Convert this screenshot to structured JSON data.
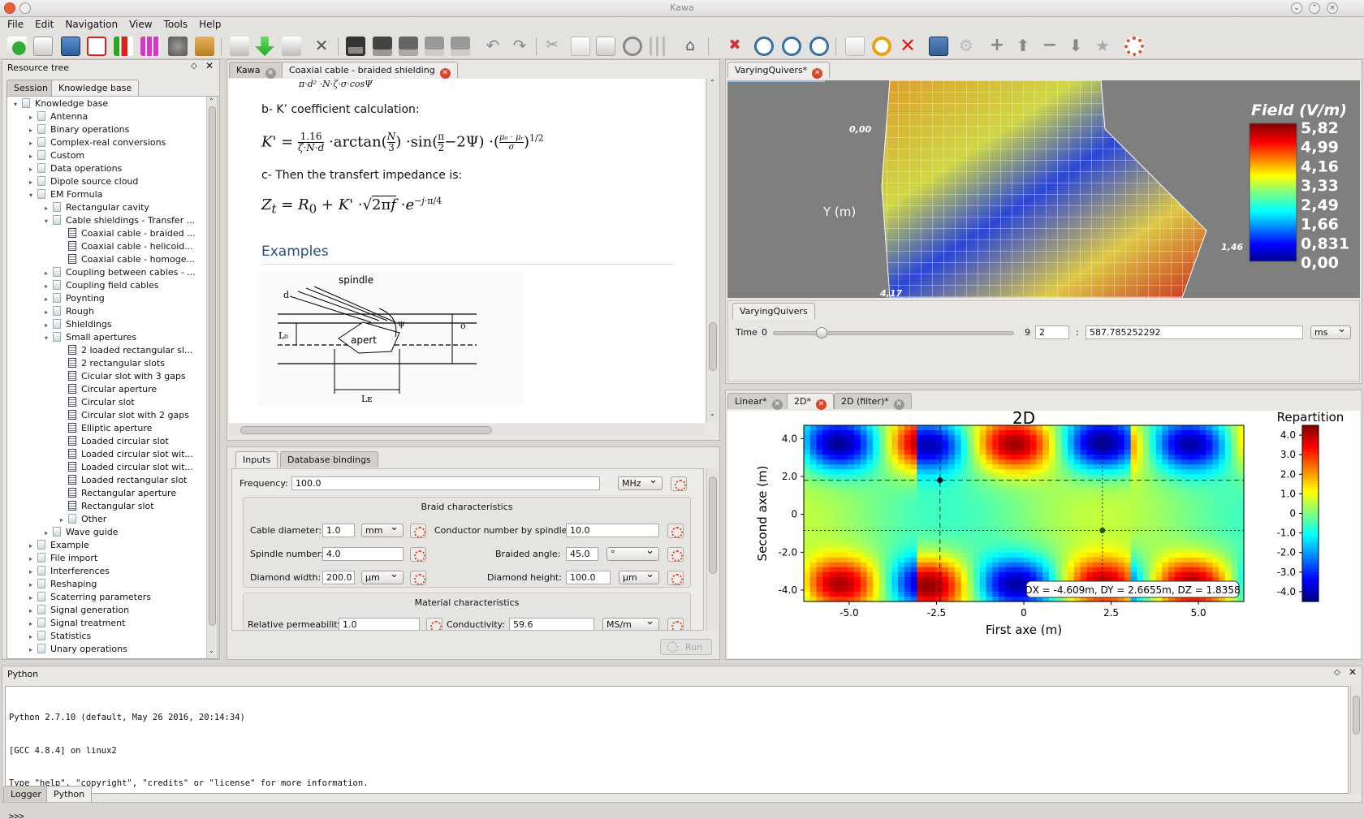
{
  "window": {
    "title": "Kawa"
  },
  "menu": [
    "File",
    "Edit",
    "Navigation",
    "View",
    "Tools",
    "Help"
  ],
  "resource_tree": {
    "title": "Resource tree",
    "tabs": [
      "Session",
      "Knowledge base"
    ],
    "items": [
      {
        "label": "Knowledge base",
        "level": 0,
        "type": "folder",
        "expanded": true
      },
      {
        "label": "Antenna",
        "level": 1,
        "type": "folder"
      },
      {
        "label": "Binary operations",
        "level": 1,
        "type": "folder"
      },
      {
        "label": "Complex-real conversions",
        "level": 1,
        "type": "folder"
      },
      {
        "label": "Custom",
        "level": 1,
        "type": "folder"
      },
      {
        "label": "Data operations",
        "level": 1,
        "type": "folder"
      },
      {
        "label": "Dipole source cloud",
        "level": 1,
        "type": "folder"
      },
      {
        "label": "EM Formula",
        "level": 1,
        "type": "folder",
        "expanded": true
      },
      {
        "label": "Rectangular cavity",
        "level": 2,
        "type": "folder"
      },
      {
        "label": "Cable shieldings - Transfer ...",
        "level": 2,
        "type": "folder",
        "expanded": true
      },
      {
        "label": "Coaxial cable - braided ...",
        "level": 3,
        "type": "doc"
      },
      {
        "label": "Coaxial cable - helicoid...",
        "level": 3,
        "type": "doc"
      },
      {
        "label": "Coaxial cable - homoge...",
        "level": 3,
        "type": "doc"
      },
      {
        "label": "Coupling between cables - ...",
        "level": 2,
        "type": "folder"
      },
      {
        "label": "Coupling field cables",
        "level": 2,
        "type": "folder"
      },
      {
        "label": "Poynting",
        "level": 2,
        "type": "folder"
      },
      {
        "label": "Rough",
        "level": 2,
        "type": "folder"
      },
      {
        "label": "Shieldings",
        "level": 2,
        "type": "folder"
      },
      {
        "label": "Small apertures",
        "level": 2,
        "type": "folder",
        "expanded": true
      },
      {
        "label": "2 loaded rectangular sl...",
        "level": 3,
        "type": "doc"
      },
      {
        "label": "2 rectangular slots",
        "level": 3,
        "type": "doc"
      },
      {
        "label": "Cicular slot with 3 gaps",
        "level": 3,
        "type": "doc"
      },
      {
        "label": "Circular aperture",
        "level": 3,
        "type": "doc"
      },
      {
        "label": "Circular slot",
        "level": 3,
        "type": "doc"
      },
      {
        "label": "Circular slot with 2 gaps",
        "level": 3,
        "type": "doc"
      },
      {
        "label": "Elliptic aperture",
        "level": 3,
        "type": "doc"
      },
      {
        "label": "Loaded circular slot",
        "level": 3,
        "type": "doc"
      },
      {
        "label": "Loaded circular slot wit...",
        "level": 3,
        "type": "doc"
      },
      {
        "label": "Loaded circular slot wit...",
        "level": 3,
        "type": "doc"
      },
      {
        "label": "Loaded rectangular slot",
        "level": 3,
        "type": "doc"
      },
      {
        "label": "Rectangular aperture",
        "level": 3,
        "type": "doc"
      },
      {
        "label": "Rectangular slot",
        "level": 3,
        "type": "doc"
      },
      {
        "label": "Other",
        "level": 3,
        "type": "folder"
      },
      {
        "label": "Wave guide",
        "level": 2,
        "type": "folder"
      },
      {
        "label": "Example",
        "level": 1,
        "type": "folder"
      },
      {
        "label": "File import",
        "level": 1,
        "type": "folder"
      },
      {
        "label": "Interferences",
        "level": 1,
        "type": "folder"
      },
      {
        "label": "Reshaping",
        "level": 1,
        "type": "folder"
      },
      {
        "label": "Scaterring parameters",
        "level": 1,
        "type": "folder"
      },
      {
        "label": "Signal generation",
        "level": 1,
        "type": "folder"
      },
      {
        "label": "Signal treatment",
        "level": 1,
        "type": "folder"
      },
      {
        "label": "Statistics",
        "level": 1,
        "type": "folder"
      },
      {
        "label": "Unary operations",
        "level": 1,
        "type": "folder"
      }
    ]
  },
  "doc": {
    "tabs": [
      "Kawa",
      "Coaxial cable - braided shielding"
    ],
    "top_formula": "π·d² ·N·ζ·σ·cosΨ",
    "step_b": "b- K’ coefficient calculation:",
    "step_c": "c- Then the transfert impedance is:",
    "examples_heading": "Examples",
    "fig_labels": {
      "spindle": "spindle",
      "d": "d",
      "psi": "ψ",
      "apert": "apert",
      "L0": "L₀",
      "o": "o",
      "LE": "Lᴇ"
    }
  },
  "inputs": {
    "tabs": [
      "Inputs",
      "Database bindings"
    ],
    "frequency_label": "Frequency:",
    "frequency_value": "100.0",
    "frequency_unit": "MHz",
    "braid_title": "Braid characteristics",
    "cable_diameter_label": "Cable diameter:",
    "cable_diameter_value": "1.0",
    "cable_diameter_unit": "mm",
    "conductor_label": "Conductor number by spindle:",
    "conductor_value": "10.0",
    "spindle_label": "Spindle number:",
    "spindle_value": "4.0",
    "braided_angle_label": "Braided angle:",
    "braided_angle_value": "45.0",
    "braided_angle_unit": "°",
    "diamond_width_label": "Diamond width:",
    "diamond_width_value": "200.0",
    "diamond_width_unit": "µm",
    "diamond_height_label": "Diamond height:",
    "diamond_height_value": "100.0",
    "diamond_height_unit": "µm",
    "material_title": "Material characteristics",
    "permeability_label": "Relative permeability:",
    "permeability_value": "1.0",
    "conductivity_label": "Conductivity:",
    "conductivity_value": "59.6",
    "conductivity_unit": "MS/m",
    "run_label": "Run"
  },
  "quivers": {
    "tab": "VaryingQuivers*",
    "axis_y": "Y (m)",
    "tick_top": "0,00",
    "tick_right": "1,46",
    "tick_bottom": "4,17",
    "colorbar_title": "Field (V/m)",
    "colorbar_ticks": [
      "5,82",
      "4,99",
      "4,16",
      "3,33",
      "2,49",
      "1,66",
      "0,831",
      "0,00"
    ],
    "controls_tab": "VaryingQuivers",
    "time_label": "Time",
    "time_min": "0",
    "time_max": "9",
    "time_value": 0.2,
    "step_value": "2",
    "time_readout": "587.785252292",
    "time_unit": "ms"
  },
  "plot2d": {
    "tabs": [
      "Linear*",
      "2D*",
      "2D (filter)*"
    ],
    "readout": "DX = -4.609m, DY = 2.6655m, DZ = 1.8358"
  },
  "chart_data": {
    "type": "heatmap",
    "title": "2D",
    "xlabel": "First axe (m)",
    "ylabel": "Second axe (m)",
    "xlim": [
      -6.3,
      6.3
    ],
    "ylim": [
      -4.6,
      4.7
    ],
    "x_ticks": [
      "-5.0",
      "-2.5",
      "0",
      "2.5",
      "5.0"
    ],
    "y_ticks": [
      "4.0",
      "2.0",
      "0",
      "-2.0",
      "-4.0"
    ],
    "colorbar_title": "Repartition",
    "colorbar_ticks": [
      "4.0",
      "3.0",
      "2.0",
      "1.0",
      "0",
      "-1.0",
      "-2.0",
      "-3.0",
      "-4.0"
    ],
    "zlim": [
      -4.5,
      4.5
    ],
    "cursors": [
      {
        "x": -2.4,
        "y": 1.8,
        "style": "dashed"
      },
      {
        "x": 2.25,
        "y": -0.85,
        "style": "dotted"
      }
    ]
  },
  "python": {
    "title": "Python",
    "lines": [
      "Python 2.7.10 (default, May 26 2016, 20:14:34)",
      "[GCC 4.8.4] on linux2",
      "Type \"help\", \"copyright\", \"credits\" or \"license\" for more information.",
      ">>>",
      ">>>"
    ],
    "bottom_tabs": [
      "Logger",
      "Python"
    ]
  },
  "colors": {
    "accent_red": "#d42e1e",
    "heading_blue": "#2a4f7e"
  }
}
